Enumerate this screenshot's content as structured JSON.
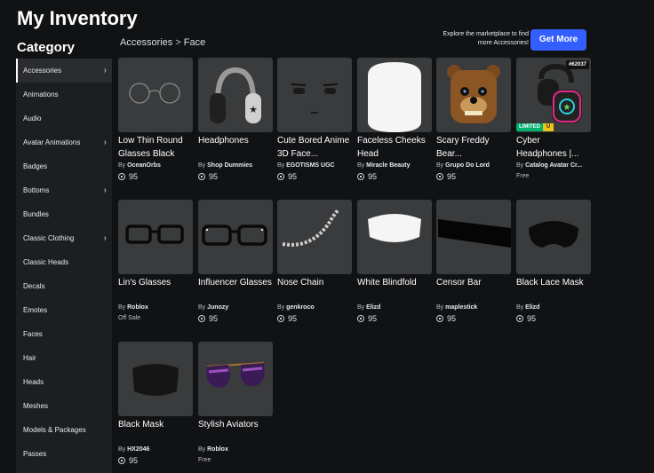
{
  "page": {
    "title": "My Inventory"
  },
  "sidebar": {
    "heading": "Category",
    "items": [
      {
        "label": "Accessories",
        "has_chevron": true
      },
      {
        "label": "Animations",
        "has_chevron": false
      },
      {
        "label": "Audio",
        "has_chevron": false
      },
      {
        "label": "Avatar Animations",
        "has_chevron": true
      },
      {
        "label": "Badges",
        "has_chevron": false
      },
      {
        "label": "Bottoms",
        "has_chevron": true
      },
      {
        "label": "Bundles",
        "has_chevron": false
      },
      {
        "label": "Classic Clothing",
        "has_chevron": true
      },
      {
        "label": "Classic Heads",
        "has_chevron": false
      },
      {
        "label": "Decals",
        "has_chevron": false
      },
      {
        "label": "Emotes",
        "has_chevron": false
      },
      {
        "label": "Faces",
        "has_chevron": false
      },
      {
        "label": "Hair",
        "has_chevron": false
      },
      {
        "label": "Heads",
        "has_chevron": false
      },
      {
        "label": "Meshes",
        "has_chevron": false
      },
      {
        "label": "Models & Packages",
        "has_chevron": false
      },
      {
        "label": "Passes",
        "has_chevron": false
      }
    ]
  },
  "breadcrumb": {
    "parent": "Accessories",
    "separator": ">",
    "current": "Face"
  },
  "promo": {
    "text": "Explore the marketplace to find more Accessories!",
    "button": "Get More"
  },
  "items": [
    {
      "name": "Low Thin Round Glasses Black",
      "by_prefix": "By",
      "creator": "OceanOrbs",
      "price": "95",
      "thumb": "round-glasses"
    },
    {
      "name": "Headphones",
      "by_prefix": "By",
      "creator": "Shop Dummies",
      "price": "95",
      "thumb": "headphones"
    },
    {
      "name": "Cute Bored Anime 3D Face...",
      "by_prefix": "By",
      "creator": "EGOTISMS UGC",
      "price": "95",
      "thumb": "bored-face"
    },
    {
      "name": "Faceless Cheeks Head",
      "by_prefix": "By",
      "creator": "Miracle Beauty",
      "price": "95",
      "thumb": "white-head"
    },
    {
      "name": "Scary Freddy Bear...",
      "by_prefix": "By",
      "creator": "Grupo Do Lord",
      "price": "95",
      "thumb": "freddy-bear"
    },
    {
      "name": "Cyber Headphones |...",
      "by_prefix": "By",
      "creator": "Catalog Avatar Cr...",
      "status": "Free",
      "thumb": "cyber-headphones",
      "limited": "LIMITED",
      "limited_u": "U",
      "serial": "#62037"
    },
    {
      "name": "Lin's Glasses",
      "by_prefix": "By",
      "creator": "Roblox",
      "status": "Off Sale",
      "thumb": "lins-glasses"
    },
    {
      "name": "Influencer Glasses",
      "by_prefix": "By",
      "creator": "Junozy",
      "price": "95",
      "thumb": "influencer-glasses"
    },
    {
      "name": "Nose Chain",
      "by_prefix": "By",
      "creator": "genkroco",
      "price": "95",
      "thumb": "nose-chain"
    },
    {
      "name": "White Blindfold",
      "by_prefix": "By",
      "creator": "Elizd",
      "price": "95",
      "thumb": "white-blindfold"
    },
    {
      "name": "Censor Bar",
      "by_prefix": "By",
      "creator": "maplestick",
      "price": "95",
      "thumb": "censor-bar"
    },
    {
      "name": "Black Lace Mask",
      "by_prefix": "By",
      "creator": "Elizd",
      "price": "95",
      "thumb": "black-lace-mask"
    },
    {
      "name": "Black Mask",
      "by_prefix": "By",
      "creator": "HX2046",
      "price": "95",
      "thumb": "black-mask"
    },
    {
      "name": "Stylish Aviators",
      "by_prefix": "By",
      "creator": "Roblox",
      "status": "Free",
      "thumb": "aviators"
    }
  ]
}
